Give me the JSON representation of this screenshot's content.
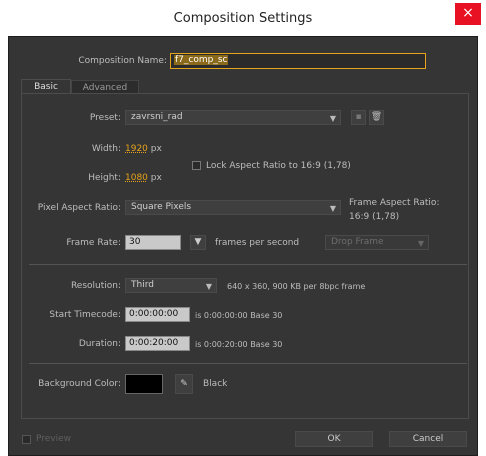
{
  "window": {
    "title": "Composition Settings",
    "close_glyph": "×"
  },
  "comp_name": {
    "label": "Composition Name:",
    "value": "f7_comp_sc"
  },
  "tabs": [
    {
      "label": "Basic"
    },
    {
      "label": "Advanced"
    }
  ],
  "preset": {
    "label": "Preset:",
    "value": "zavrsni_rad"
  },
  "width": {
    "label": "Width:",
    "value": "1920",
    "unit": "px"
  },
  "height": {
    "label": "Height:",
    "value": "1080",
    "unit": "px"
  },
  "lock_aspect": {
    "label": "Lock Aspect Ratio to 16:9 (1,78)",
    "checked": false
  },
  "pixel_aspect": {
    "label": "Pixel Aspect Ratio:",
    "value": "Square Pixels"
  },
  "frame_aspect": {
    "label": "Frame Aspect Ratio:",
    "value": "16:9 (1,78)"
  },
  "frame_rate": {
    "label": "Frame Rate:",
    "value": "30",
    "unit": "frames per second",
    "drop_frame": "Drop Frame"
  },
  "resolution": {
    "label": "Resolution:",
    "value": "Third",
    "info": "640 x 360, 900 KB per 8bpc frame"
  },
  "start_timecode": {
    "label": "Start Timecode:",
    "value": "0:00:00:00",
    "info": "is 0:00:00:00  Base 30"
  },
  "duration": {
    "label": "Duration:",
    "value": "0:00:20:00",
    "info": "is 0:00:20:00  Base 30"
  },
  "background": {
    "label": "Background Color:",
    "name": "Black",
    "color": "#000000"
  },
  "footer": {
    "preview": "Preview",
    "ok": "OK",
    "cancel": "Cancel"
  },
  "colors": {
    "accent_value": "#e5a21b",
    "panel_bg": "#353535",
    "close_bg": "#e81123"
  }
}
